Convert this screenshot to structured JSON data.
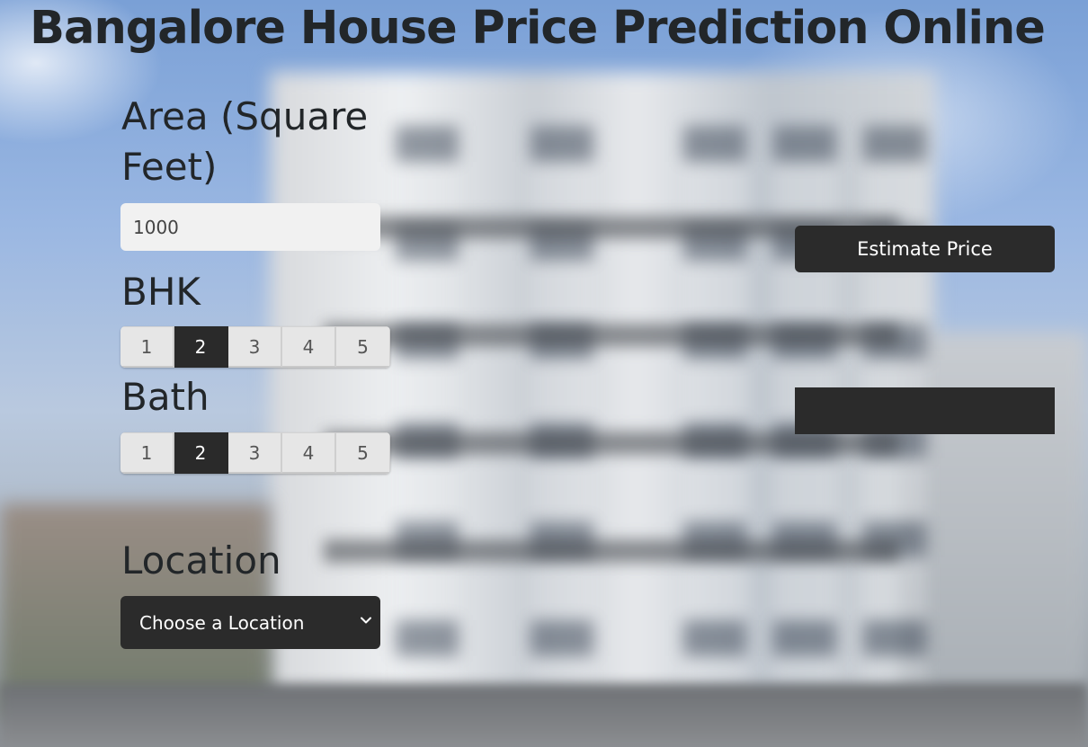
{
  "page": {
    "title": "Bangalore House Price Prediction Online"
  },
  "area": {
    "label": "Area (Square Feet)",
    "value": "1000"
  },
  "bhk": {
    "label": "BHK",
    "options": [
      "1",
      "2",
      "3",
      "4",
      "5"
    ],
    "selected": "2"
  },
  "bath": {
    "label": "Bath",
    "options": [
      "1",
      "2",
      "3",
      "4",
      "5"
    ],
    "selected": "2"
  },
  "location": {
    "label": "Location",
    "selected_text": "Choose a Location",
    "icon": "chevron-down-icon"
  },
  "estimate": {
    "button_label": "Estimate Price",
    "result_text": ""
  },
  "colors": {
    "dark": "#2b2b2b",
    "text": "#222629",
    "input_bg": "#f1f1f1",
    "option_bg": "#e6e6e6"
  }
}
